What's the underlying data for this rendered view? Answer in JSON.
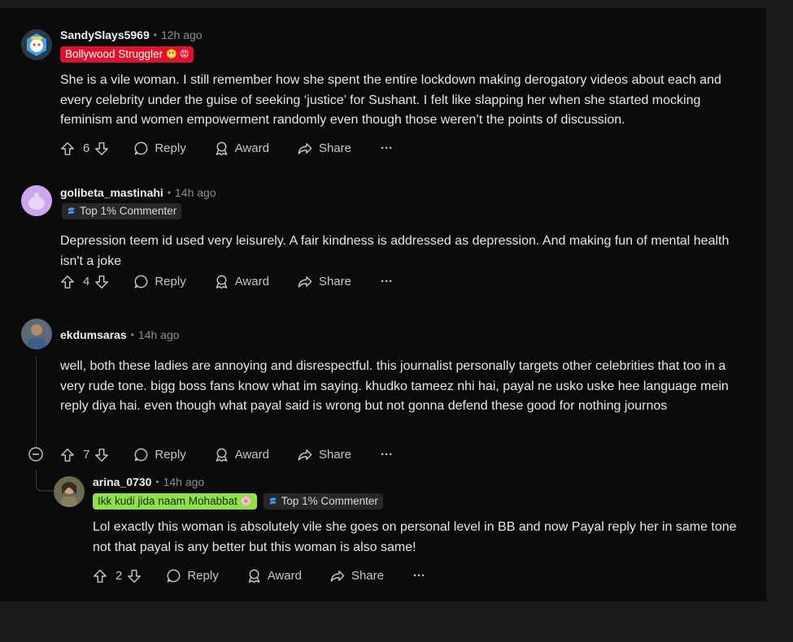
{
  "comments": [
    {
      "username": "SandySlays5969",
      "time": "12h ago",
      "flairs": [
        {
          "text": "Bollywood Struggler",
          "style": "red",
          "emoji": "😬 😡"
        }
      ],
      "body": "She is a vile woman. I still remember how she spent the entire lockdown making derogatory videos about each and every celebrity under the guise of seeking ‘justice’ for Sushant. I felt like slapping her when she started mocking feminism and women empowerment randomly even though those weren’t the points of discussion.",
      "score": "6"
    },
    {
      "username": "golibeta_mastinahi",
      "time": "14h ago",
      "flairs": [
        {
          "text": "Top 1% Commenter",
          "style": "dark"
        }
      ],
      "body": "Depression teem id used very leisurely. A fair kindness is addressed as depression. And making fun of mental health isn't a joke",
      "score": "4"
    },
    {
      "username": "ekdumsaras",
      "time": "14h ago",
      "flairs": [],
      "body": "well, both these ladies are annoying and disrespectful. this journalist personally targets other celebrities that too in a very rude tone. bigg boss fans know what im saying. khudko tameez nhi hai, payal ne usko uske hee language mein reply diya hai. even though what payal said is wrong but not gonna defend these good for nothing journos",
      "score": "7"
    },
    {
      "username": "arina_0730",
      "time": "14h ago",
      "flairs": [
        {
          "text": "Ikk kudi jida naam Mohabbat",
          "style": "green",
          "emoji": "🌸"
        },
        {
          "text": "Top 1% Commenter",
          "style": "dark"
        }
      ],
      "body": "Lol exactly this woman is absolutely vile she goes on personal level in BB and now Payal reply her in same tone not that payal is any better but this woman is also same!",
      "score": "2"
    }
  ],
  "labels": {
    "reply": "Reply",
    "award": "Award",
    "share": "Share",
    "more": "···",
    "separator": "•"
  },
  "colors": {
    "background": "#0b0b0b",
    "flair_red": "#e0122b",
    "flair_green": "#8fe14a",
    "text": "#e4e6e8",
    "muted": "#8b8f92"
  }
}
